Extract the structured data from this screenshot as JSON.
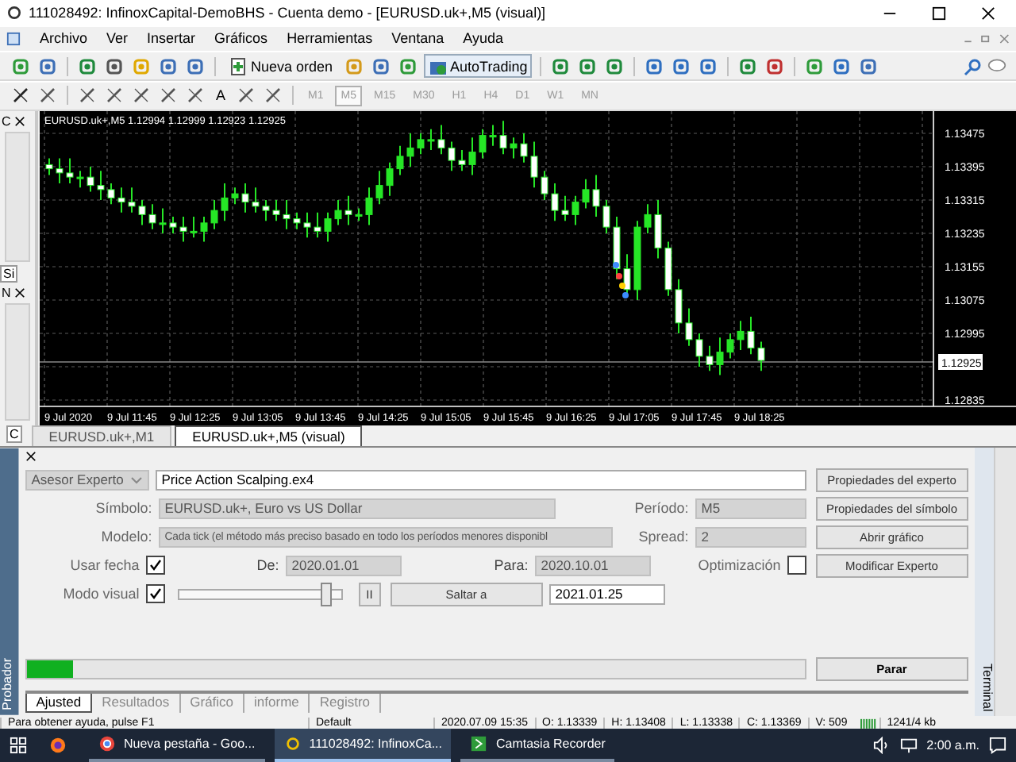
{
  "window": {
    "title": "111028492: InfinoxCapital-DemoBHS - Cuenta demo - [EURUSD.uk+,M5 (visual)]"
  },
  "menu": [
    "Archivo",
    "Ver",
    "Insertar",
    "Gráficos",
    "Herramientas",
    "Ventana",
    "Ayuda"
  ],
  "toolbar": {
    "new_order": "Nueva orden",
    "autotrading": "AutoTrading",
    "text_tool": "A"
  },
  "timeframes": [
    {
      "label": "M1",
      "selected": false
    },
    {
      "label": "M5",
      "selected": true
    },
    {
      "label": "M15",
      "selected": false
    },
    {
      "label": "M30",
      "selected": false
    },
    {
      "label": "H1",
      "selected": false
    },
    {
      "label": "H4",
      "selected": false
    },
    {
      "label": "D1",
      "selected": false
    },
    {
      "label": "W1",
      "selected": false
    },
    {
      "label": "MN",
      "selected": false
    }
  ],
  "side_panel": {
    "market_watch_tab": "C",
    "symbols_tab": "Si",
    "navigator_tab": "N",
    "common_tab": "C"
  },
  "chart": {
    "header": "EURUSD.uk+,M5  1.12994 1.12999 1.12923 1.12925",
    "price_labels": [
      "1.13475",
      "1.13395",
      "1.13315",
      "1.13235",
      "1.13155",
      "1.13075",
      "1.12995",
      "1.12835"
    ],
    "current_price": "1.12925",
    "time_labels": [
      "9 Jul 2020",
      "9 Jul 11:45",
      "9 Jul 12:25",
      "9 Jul 13:05",
      "9 Jul 13:45",
      "9 Jul 14:25",
      "9 Jul 15:05",
      "9 Jul 15:45",
      "9 Jul 16:25",
      "9 Jul 17:05",
      "9 Jul 17:45",
      "9 Jul 18:25"
    ]
  },
  "chart_tabs": [
    {
      "label": "EURUSD.uk+,M1",
      "selected": false
    },
    {
      "label": "EURUSD.uk+,M5 (visual)",
      "selected": true
    }
  ],
  "tester": {
    "side_label": "Probador",
    "terminal_label": "Terminal",
    "expert_type": {
      "value": "Asesor Experto",
      "disabled": true
    },
    "expert": {
      "value": "Price Action Scalping.ex4",
      "disabled": false
    },
    "symbol": {
      "label": "Símbolo:",
      "value": "EURUSD.uk+, Euro vs US Dollar",
      "disabled": true
    },
    "period": {
      "label": "Período:",
      "value": "M5",
      "disabled": true
    },
    "model": {
      "label": "Modelo:",
      "value": "Cada tick (el método más preciso basado en todo los períodos menores disponibl",
      "disabled": true
    },
    "spread": {
      "label": "Spread:",
      "value": "2",
      "disabled": true
    },
    "use_date": {
      "label": "Usar fecha",
      "checked": true
    },
    "from": {
      "label": "De:",
      "value": "2020.01.01",
      "disabled": true
    },
    "to": {
      "label": "Para:",
      "value": "2020.10.01",
      "disabled": true
    },
    "optimization": {
      "label": "Optimización",
      "checked": false
    },
    "visual_mode": {
      "label": "Modo visual",
      "checked": true
    },
    "speed": {
      "level": 0.9
    },
    "pause_button": "II",
    "skip_to_button": "Saltar a",
    "skip_to_date": {
      "value": "2021.01.25",
      "disabled": false
    },
    "buttons": {
      "expert_properties": "Propiedades del experto",
      "symbol_properties": "Propiedades del símbolo",
      "open_chart": "Abrir gráfico",
      "modify_expert": "Modificar Experto",
      "stop": "Parar"
    },
    "progress": {
      "level": 0.06
    },
    "tabs": [
      {
        "label": "Ajusted",
        "selected": true
      },
      {
        "label": "Resultados",
        "selected": false
      },
      {
        "label": "Gráfico",
        "selected": false
      },
      {
        "label": "informe",
        "selected": false
      },
      {
        "label": "Registro",
        "selected": false
      }
    ]
  },
  "status_bar": {
    "help": "Para obtener ayuda, pulse F1",
    "profile": "Default",
    "fields": [
      "2020.07.09 15:35",
      "O: 1.13339",
      "H: 1.13408",
      "L: 1.13338",
      "C: 1.13369",
      "V: 509"
    ],
    "traffic": "1241/4 kb"
  },
  "taskbar": {
    "items": [
      {
        "label": "Nueva pestaña - Goo...",
        "selected": false,
        "kind": "browser"
      },
      {
        "label": "111028492: InfinoxCa...",
        "selected": true,
        "kind": "terminal"
      },
      {
        "label": "Camtasia Recorder",
        "selected": false,
        "kind": "recorder"
      }
    ],
    "time": "2:00 a.m."
  }
}
